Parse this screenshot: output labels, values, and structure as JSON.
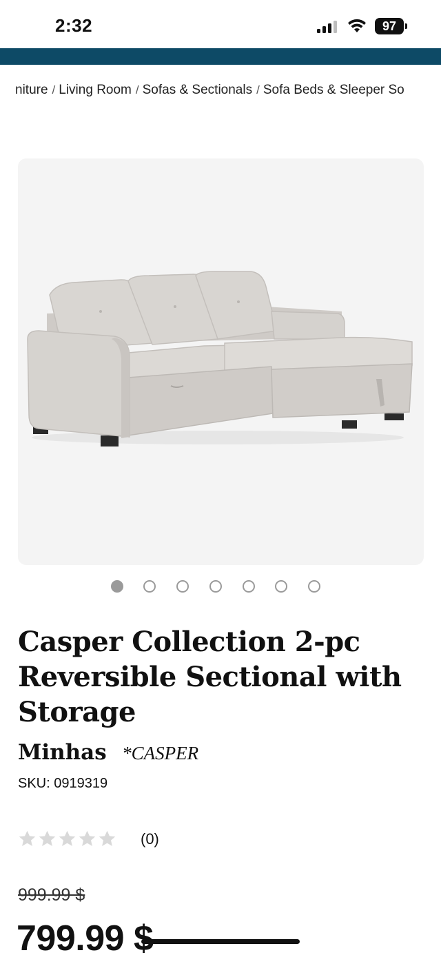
{
  "status_bar": {
    "time": "2:32",
    "battery": "97",
    "icons": [
      "signal-icon",
      "wifi-icon",
      "battery-icon"
    ]
  },
  "colors": {
    "brand_bar": "#0d4a66",
    "image_bg": "#f4f4f4",
    "star_empty": "#d9d9d9",
    "dot": "#9a9a9a"
  },
  "breadcrumb": {
    "items": [
      "niture",
      "Living Room",
      "Sofas & Sectionals",
      "Sofa Beds & Sleeper So"
    ],
    "separator": "/"
  },
  "product_image": {
    "alt": "Casper Collection 2-pc Reversible Sectional with Storage",
    "slide_count": 7,
    "active_slide": 1
  },
  "product": {
    "title": "Casper Collection 2-pc Reversible Sectional with Storage",
    "brand": "Minhas",
    "collection": "*CASPER",
    "sku": "SKU: 0919319",
    "rating_stars": 0,
    "rating_max": 5,
    "review_count": "(0)",
    "old_price": "999.99 $",
    "current_price": "799.99 $"
  }
}
